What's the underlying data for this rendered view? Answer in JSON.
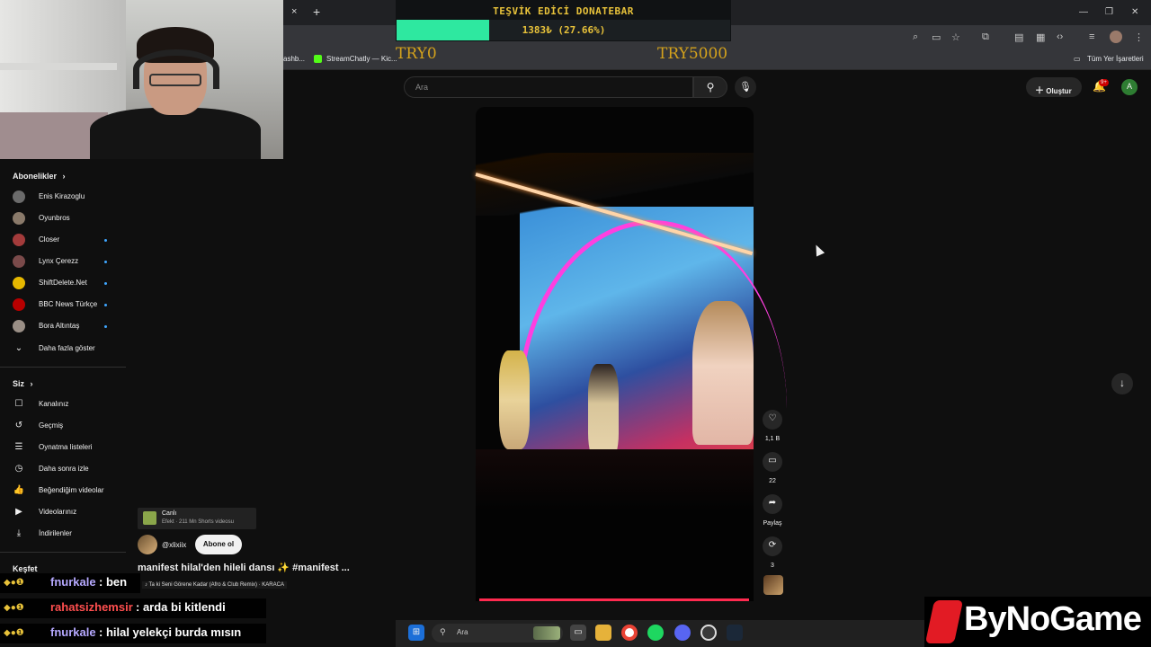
{
  "browser": {
    "new_tab": "+",
    "close_tab": "×",
    "bookmarks": [
      "ashb...",
      "StreamChatly — Kic..."
    ],
    "all_bookmarks": "Tüm Yer İşaretleri",
    "window_controls": [
      "—",
      "❐",
      "✕"
    ]
  },
  "donation": {
    "title": "TEŞVİK EDİCİ DONATEBAR",
    "amount_text": "1383₺ (27.66%)",
    "progress": 0.2766,
    "min_label": "TRY0",
    "max_label": "TRY5000",
    "fill_color": "#2ee8a0",
    "text_color": "#e8c23a"
  },
  "header": {
    "search_placeholder": "Ara",
    "search_icon": "search-icon",
    "create_label": "Oluştur",
    "notif_badge": "9+",
    "avatar_letter": "A"
  },
  "sidebar": {
    "subscriptions_title": "Abonelikler",
    "subscriptions": [
      {
        "label": "Enis Kirazoglu",
        "color": "#6b6b6b",
        "dot": false
      },
      {
        "label": "Oyunbros",
        "color": "#8a7a6a",
        "dot": false
      },
      {
        "label": "Closer",
        "color": "#a33b3b",
        "dot": true
      },
      {
        "label": "Lynx Çerezz",
        "color": "#7a4a4a",
        "dot": true
      },
      {
        "label": "ShiftDelete.Net",
        "color": "#e6b800",
        "dot": true
      },
      {
        "label": "BBC News Türkçe",
        "color": "#b80000",
        "dot": true
      },
      {
        "label": "Bora Altıntaş",
        "color": "#9a8f86",
        "dot": true
      }
    ],
    "show_more": "Daha fazla göster",
    "you_title": "Siz",
    "you_items": [
      {
        "label": "Kanalınız",
        "icon": "channel-icon"
      },
      {
        "label": "Geçmiş",
        "icon": "history-icon"
      },
      {
        "label": "Oynatma listeleri",
        "icon": "playlist-icon"
      },
      {
        "label": "Daha sonra izle",
        "icon": "clock-icon"
      },
      {
        "label": "Beğendiğim videolar",
        "icon": "thumbs-up-icon"
      },
      {
        "label": "Videolarınız",
        "icon": "video-icon"
      },
      {
        "label": "İndirilenler",
        "icon": "download-icon"
      }
    ],
    "explore_title": "Keşfet"
  },
  "short": {
    "like_count": "1,1 B",
    "comment_count": "22",
    "share_label": "Paylaş",
    "remix_count": "3",
    "live_card_title": "Canlı",
    "live_card_sub": "Efekt · 211 Mn Shorts videosu",
    "channel": "@xlixiix",
    "subscribe_label": "Abone ol",
    "title": "manifest hilal'den hileli dansı ✨ #manifest ...",
    "music": "♪ Ta ki Seni Görene Kadar (Afro & Club Remix) · KARACA"
  },
  "chat": [
    {
      "user": "fnurkale",
      "message": ": ben",
      "user_color": "#b6a9ff"
    },
    {
      "user": "rahatsizhemsir",
      "message": ": arda bi kitlendi",
      "user_color": "#ff4f4f"
    },
    {
      "user": "fnurkale",
      "message": ": hilal yelekçi burda mısın",
      "user_color": "#b6a9ff"
    }
  ],
  "taskbar": {
    "search_label": "Ara"
  },
  "logo": {
    "text": "ByNoGame"
  }
}
